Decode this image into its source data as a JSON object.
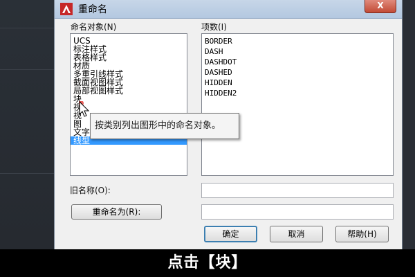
{
  "dialog": {
    "title": "重命名",
    "close_label": "X"
  },
  "left_panel": {
    "header": "命名对象(N)",
    "items": [
      {
        "label": "UCS"
      },
      {
        "label": "标注样式"
      },
      {
        "label": "表格样式"
      },
      {
        "label": "材质"
      },
      {
        "label": "多重引线样式"
      },
      {
        "label": "截面视图样式"
      },
      {
        "label": "局部视图样式"
      },
      {
        "label": "块"
      },
      {
        "label": "视"
      },
      {
        "label": "视"
      },
      {
        "label": "图"
      },
      {
        "label": "文字样式"
      },
      {
        "label": "线型"
      }
    ],
    "selected_index": 12
  },
  "right_panel": {
    "header": "项数(I)",
    "items": [
      "BORDER",
      "DASH",
      "DASHDOT",
      "DASHED",
      "HIDDEN",
      "HIDDEN2"
    ]
  },
  "old_name": {
    "label": "旧名称(O):",
    "value": ""
  },
  "rename_to": {
    "button_label": "重命名为(R):",
    "value": ""
  },
  "buttons": {
    "ok": "确定",
    "cancel": "取消",
    "help": "帮助(H)"
  },
  "tooltip": "按类别列出图形中的命名对象。",
  "caption": "点击【块】",
  "colors": {
    "selection": "#3399ff",
    "titlebar": "#b9cde4",
    "close": "#c24a35"
  }
}
